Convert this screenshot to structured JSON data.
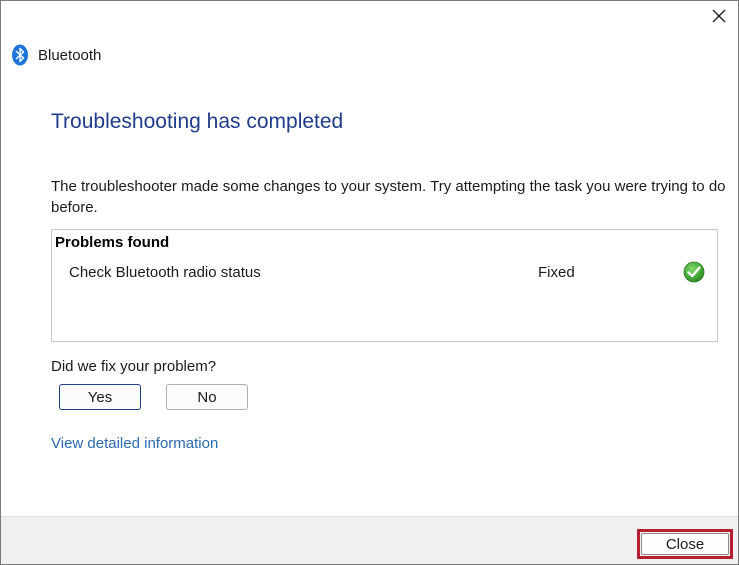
{
  "window": {
    "title": "Bluetooth"
  },
  "main": {
    "heading": "Troubleshooting has completed",
    "description": "The troubleshooter made some changes to your system. Try attempting the task you were trying to do before."
  },
  "problems": {
    "title": "Problems found",
    "items": [
      {
        "name": "Check Bluetooth radio status",
        "status": "Fixed",
        "status_icon": "green-check-icon"
      }
    ]
  },
  "feedback": {
    "question": "Did we fix your problem?",
    "yes_label": "Yes",
    "no_label": "No"
  },
  "links": {
    "details": "View detailed information"
  },
  "footer": {
    "close_label": "Close"
  },
  "colors": {
    "heading": "#1f3d8a",
    "link": "#2a6bb1",
    "highlight": "#b51f2f",
    "success": "#3aa23a",
    "bluetooth": "#1f75d8"
  }
}
